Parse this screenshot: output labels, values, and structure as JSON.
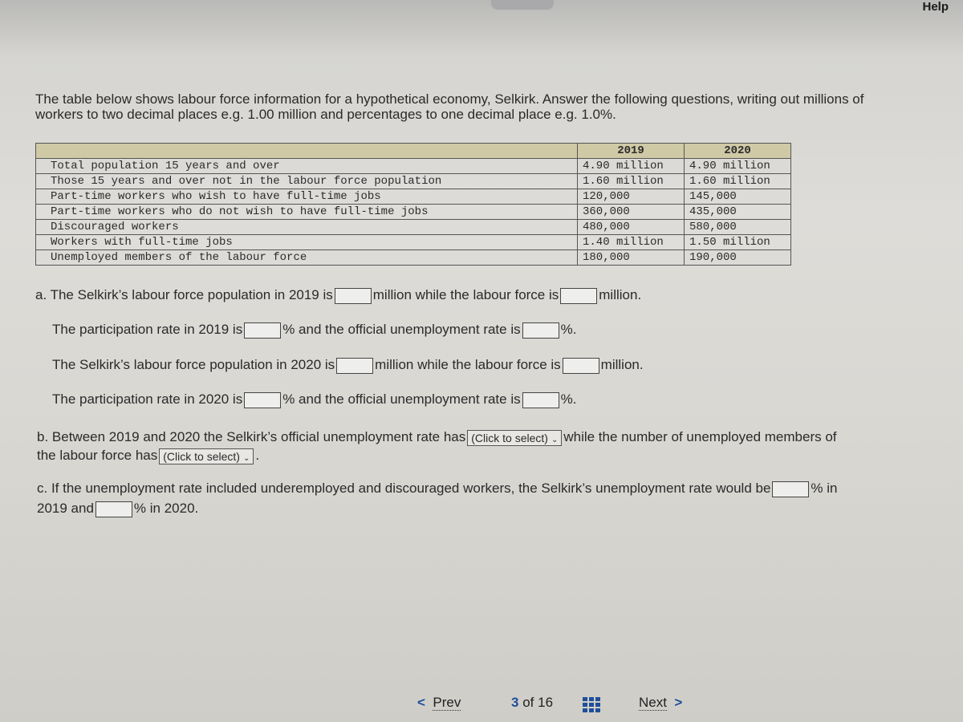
{
  "header": {
    "help_label": "Help"
  },
  "intro": "The table below shows labour force information for a hypothetical economy, Selkirk. Answer the following questions, writing out millions of workers to two decimal places e.g. 1.00 million and percentages to one decimal place e.g. 1.0%.",
  "table": {
    "columns": [
      "",
      "2019",
      "2020"
    ],
    "rows": [
      {
        "label": "Total population 15 years and over",
        "y2019": "4.90 million",
        "y2020": "4.90 million"
      },
      {
        "label": "Those 15 years and over not in the labour force population",
        "y2019": "1.60 million",
        "y2020": "1.60 million"
      },
      {
        "label": "Part-time workers who wish to have full-time jobs",
        "y2019": "120,000",
        "y2020": "145,000"
      },
      {
        "label": "Part-time workers who do not wish to have full-time jobs",
        "y2019": "360,000",
        "y2020": "435,000"
      },
      {
        "label": "Discouraged workers",
        "y2019": "480,000",
        "y2020": "580,000"
      },
      {
        "label": "Workers with full-time jobs",
        "y2019": "1.40 million",
        "y2020": "1.50 million"
      },
      {
        "label": "Unemployed members of the labour force",
        "y2019": "180,000",
        "y2020": "190,000"
      }
    ]
  },
  "questions": {
    "a1": {
      "t1": "a. The Selkirk’s labour force population in 2019 is",
      "t2": "million while the labour force is",
      "t3": "million."
    },
    "a2": {
      "t1": "The participation rate in 2019 is",
      "t2": "% and the official unemployment rate is",
      "t3": "%."
    },
    "a3": {
      "t1": "The Selkirk’s labour force population in 2020 is",
      "t2": "million while the labour force is",
      "t3": "million."
    },
    "a4": {
      "t1": "The participation rate in 2020 is",
      "t2": "% and the official unemployment rate is",
      "t3": "%."
    },
    "b": {
      "t1": "b. Between 2019 and 2020 the Selkirk’s official unemployment rate has",
      "t2": "while the number of unemployed members of",
      "t3": "the labour force has",
      "t4": ".",
      "select_label": "(Click to select)"
    },
    "c": {
      "t1": "c. If the unemployment rate included underemployed and discouraged workers, the Selkirk’s unemployment rate would be",
      "t2": "% in",
      "t3": "2019 and",
      "t4": "% in 2020."
    }
  },
  "nav": {
    "prev_label": "Prev",
    "page_current": "3",
    "page_sep": "of",
    "page_total": "16",
    "next_label": "Next"
  }
}
